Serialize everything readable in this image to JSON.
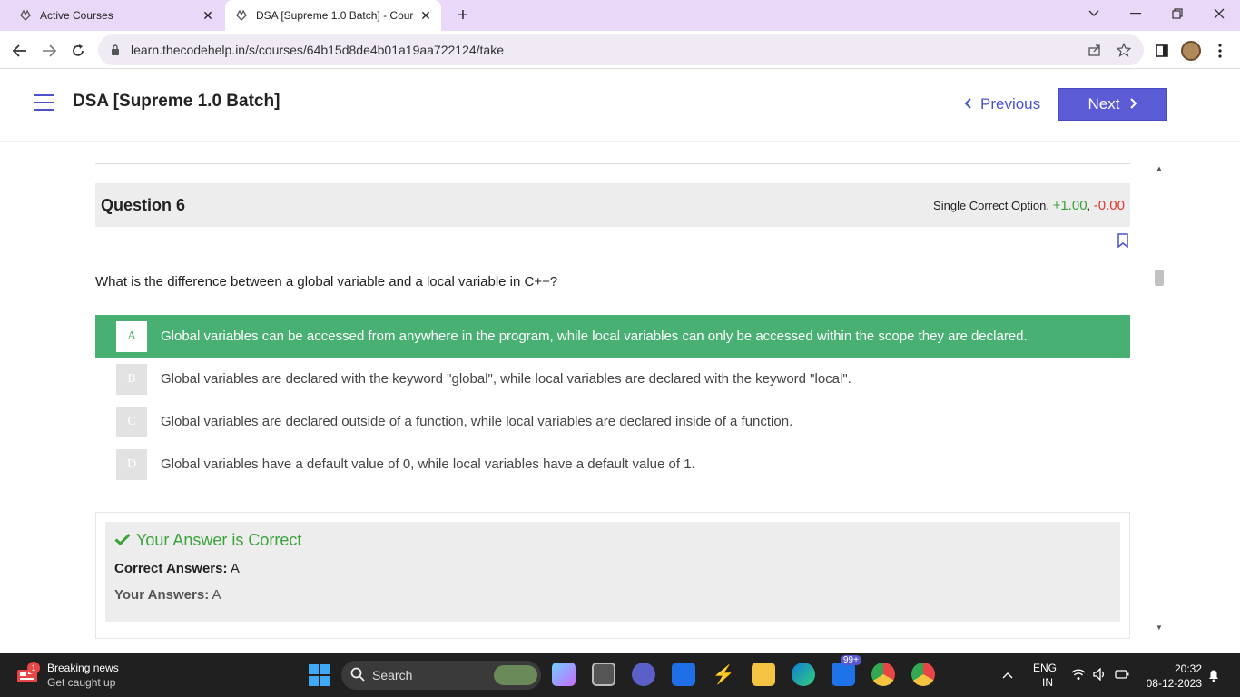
{
  "browser": {
    "tabs": [
      {
        "title": "Active Courses",
        "active": false
      },
      {
        "title": "DSA [Supreme 1.0 Batch] - Cour",
        "active": true
      }
    ],
    "url": "learn.thecodehelp.in/s/courses/64b15d8de4b01a19aa722124/take"
  },
  "header": {
    "course_title": "DSA [Supreme 1.0 Batch]",
    "previous_label": "Previous",
    "next_label": "Next"
  },
  "question": {
    "title": "Question 6",
    "type_label": "Single Correct Option,",
    "plus_marks": "+1.00",
    "minus_marks": "-0.00",
    "text": "What is the difference between a global variable and a local variable in C++?",
    "options": [
      {
        "letter": "A",
        "text": "Global variables can be accessed from anywhere in the program, while local variables can only be accessed within the scope they are declared.",
        "selected": true
      },
      {
        "letter": "B",
        "text": "Global variables are declared with the keyword \"global\", while local variables are declared with the keyword \"local\".",
        "selected": false
      },
      {
        "letter": "C",
        "text": "Global variables are declared outside of a function, while local variables are declared inside of a function.",
        "selected": false
      },
      {
        "letter": "D",
        "text": "Global variables have a default value of 0, while local variables have a default value of 1.",
        "selected": false
      }
    ]
  },
  "result": {
    "verdict": "Your Answer is Correct",
    "correct_label": "Correct Answers:",
    "correct_value": "A",
    "your_label": "Your Answers:",
    "your_value": "A"
  },
  "taskbar": {
    "news_title": "Breaking news",
    "news_sub": "Get caught up",
    "news_badge": "1",
    "search_label": "Search",
    "mail_badge": "99+",
    "lang": "ENG",
    "region": "IN",
    "time": "20:32",
    "date": "08-12-2023"
  },
  "colors": {
    "accent": "#5b5bd6",
    "correct_green": "#48b072",
    "plus_green": "#3aa33a",
    "minus_red": "#e03a2f"
  }
}
